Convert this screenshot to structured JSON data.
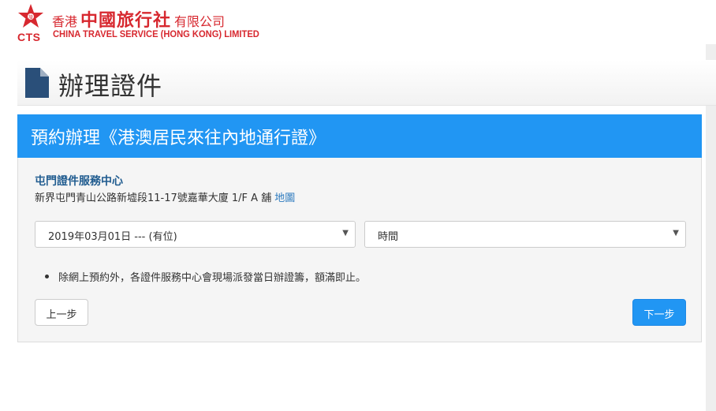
{
  "header": {
    "logo_cts": "CTS",
    "logo_cn_prefix": "香港",
    "logo_cn_main": "中國旅行社",
    "logo_cn_suffix": "有限公司",
    "logo_en": "CHINA TRAVEL SERVICE (HONG KONG) LIMITED",
    "brand_color": "#d7282f"
  },
  "page": {
    "title": "辦理證件",
    "title_icon": "document-icon"
  },
  "panel": {
    "title": "預約辦理《港澳居民來往內地通行證》",
    "header_color": "#2196f3",
    "center_name": "屯門證件服務中心",
    "center_address": "新界屯門青山公路新墟段11-17號嘉華大廈 1/F A 舖",
    "map_link": "地圖",
    "date_select": "2019年03月01日 --- (有位)",
    "time_select": "時間",
    "note": "除網上預約外，各證件服務中心會現場派發當日辦證籌，額滿即止。",
    "prev_button": "上一步",
    "next_button": "下一步"
  }
}
